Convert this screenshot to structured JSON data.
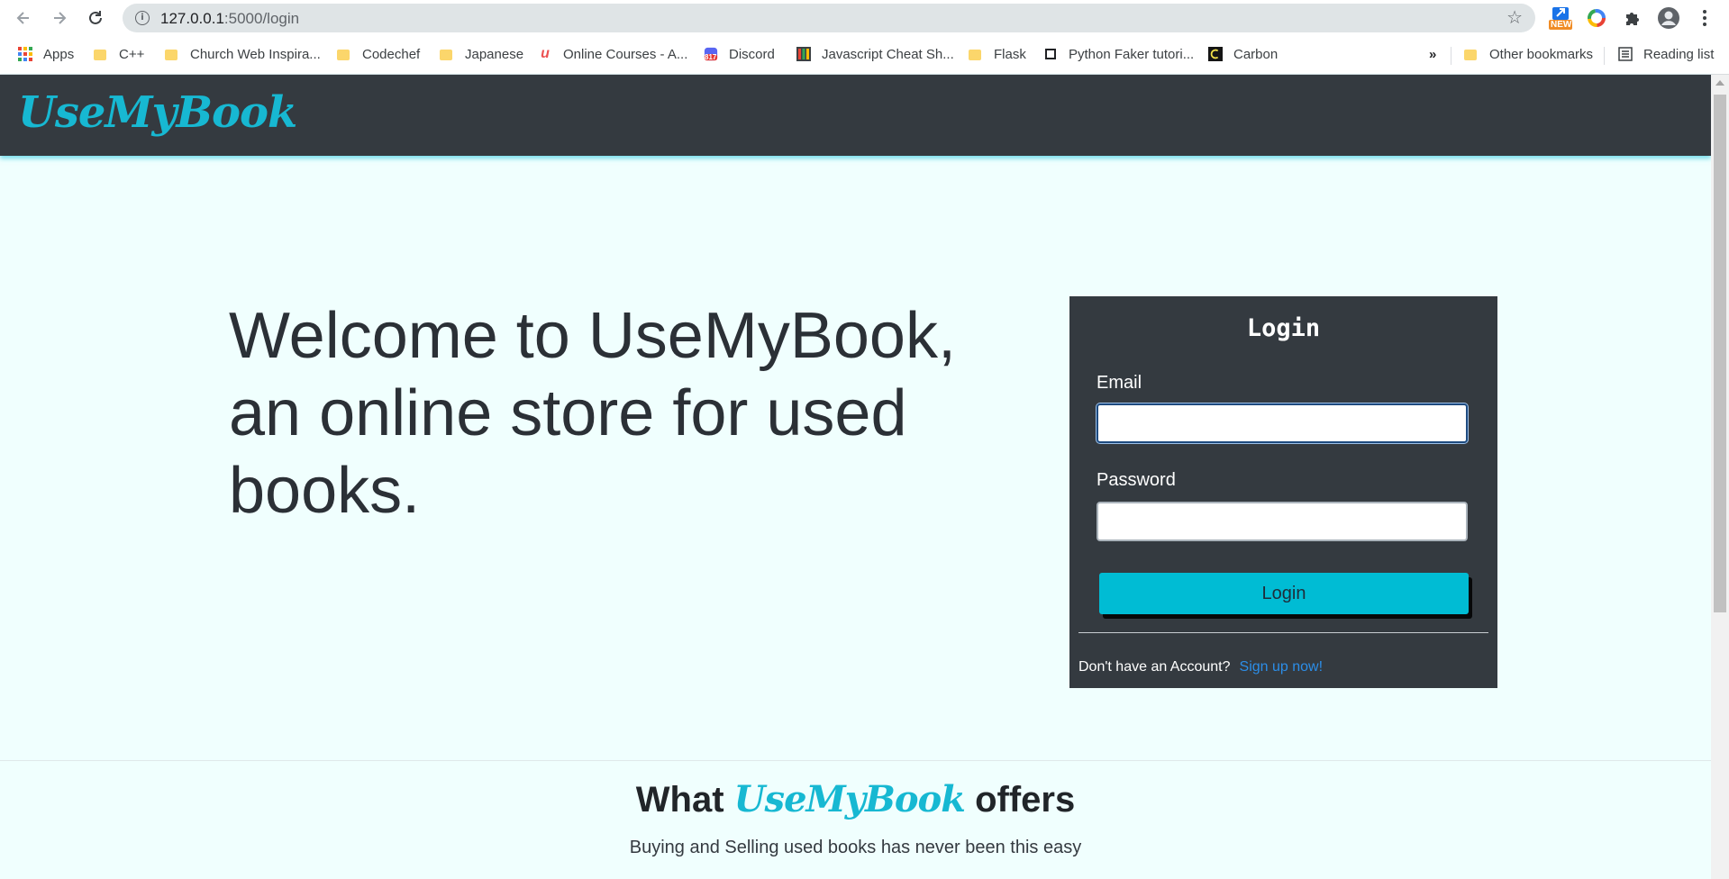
{
  "browser": {
    "url_host": "127.0.0.1",
    "url_path": ":5000/login",
    "ext_new_badge": "NEW",
    "bookmarks": [
      {
        "label": "Apps",
        "icon": "apps-grid-icon"
      },
      {
        "label": "C++",
        "icon": "folder-icon"
      },
      {
        "label": "Church Web Inspira...",
        "icon": "folder-icon"
      },
      {
        "label": "Codechef",
        "icon": "folder-icon"
      },
      {
        "label": "Japanese",
        "icon": "folder-icon"
      },
      {
        "label": "Online Courses - A...",
        "icon": "udemy-icon"
      },
      {
        "label": "Discord",
        "icon": "discord-icon"
      },
      {
        "label": "Javascript Cheat Sh...",
        "icon": "cheatsheet-icon"
      },
      {
        "label": "Flask",
        "icon": "folder-icon"
      },
      {
        "label": "Python Faker tutori...",
        "icon": "page-icon"
      },
      {
        "label": "Carbon",
        "icon": "carbon-icon"
      }
    ],
    "more": "»",
    "other_bookmarks": "Other bookmarks",
    "reading_list": "Reading list",
    "discord_badge": "817"
  },
  "site": {
    "brand": "UseMyBook",
    "welcome_text": "Welcome to UseMyBook, an online store for used books.",
    "login": {
      "title": "Login",
      "email_label": "Email",
      "password_label": "Password",
      "button_label": "Login",
      "no_account_text": "Don't have an Account?",
      "signup_link": "Sign up now!"
    },
    "offers": {
      "title_prefix": "What",
      "title_brand": "UseMyBook",
      "title_suffix": "offers",
      "subtitle": "Buying and Selling used books has never been this easy"
    }
  },
  "colors": {
    "accent": "#17b8d2",
    "nav_bg": "#343a40",
    "page_bg": "#f0fffe",
    "button": "#00bcd4",
    "link": "#2c8ee8"
  }
}
